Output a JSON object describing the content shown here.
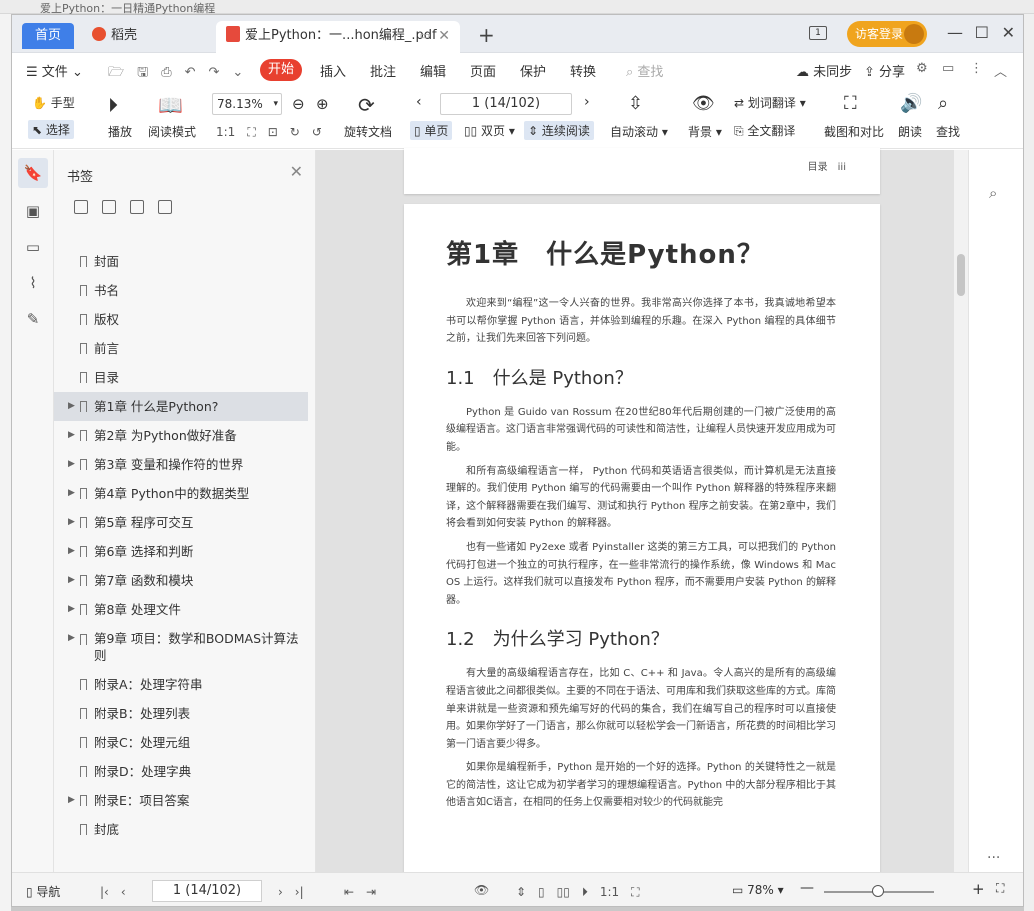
{
  "tabs": {
    "home": "首页",
    "daoke": "稻壳",
    "doc": "爱上Python：一...hon编程_.pdf"
  },
  "account": {
    "guest": "访客登录"
  },
  "menu": {
    "file": "文件",
    "start": "开始",
    "insert": "插入",
    "annotate": "批注",
    "edit": "编辑",
    "page": "页面",
    "protect": "保护",
    "convert": "转换",
    "search": "查找",
    "unsync": "未同步",
    "share": "分享"
  },
  "ribbon": {
    "hand": "手型",
    "select": "选择",
    "play": "播放",
    "read_mode": "阅读模式",
    "zoom": "78.13%",
    "rotate": "旋转文档",
    "page_field": "1 (14/102)",
    "single": "单页",
    "double": "双页",
    "continuous": "连续阅读",
    "auto_scroll": "自动滚动",
    "background": "背景",
    "word_translate": "划词翻译",
    "full_translate": "全文翻译",
    "screenshot": "截图和对比",
    "read_aloud": "朗读",
    "find": "查找"
  },
  "bookmarks": {
    "title": "书签",
    "items": [
      {
        "label": "封面",
        "expandable": false
      },
      {
        "label": "书名",
        "expandable": false
      },
      {
        "label": "版权",
        "expandable": false
      },
      {
        "label": "前言",
        "expandable": false
      },
      {
        "label": "目录",
        "expandable": false
      },
      {
        "label": "第1章 什么是Python?",
        "expandable": true,
        "selected": true
      },
      {
        "label": "第2章 为Python做好准备",
        "expandable": true
      },
      {
        "label": "第3章 变量和操作符的世界",
        "expandable": true
      },
      {
        "label": "第4章 Python中的数据类型",
        "expandable": true
      },
      {
        "label": "第5章 程序可交互",
        "expandable": true
      },
      {
        "label": "第6章 选择和判断",
        "expandable": true
      },
      {
        "label": "第7章 函数和模块",
        "expandable": true
      },
      {
        "label": "第8章 处理文件",
        "expandable": true
      },
      {
        "label": "第9章 项目：数学和BODMAS计算法则",
        "expandable": true,
        "two_line": true
      },
      {
        "label": "附录A：处理字符串",
        "expandable": false
      },
      {
        "label": "附录B：处理列表",
        "expandable": false
      },
      {
        "label": "附录C：处理元组",
        "expandable": false
      },
      {
        "label": "附录D：处理字典",
        "expandable": false
      },
      {
        "label": "附录E：项目答案",
        "expandable": true
      },
      {
        "label": "封底",
        "expandable": false
      }
    ]
  },
  "document": {
    "prev_page_header": "目录　iii",
    "chapter_title": "第1章　什么是Python？",
    "intro": "欢迎来到“编程”这一令人兴奋的世界。我非常高兴你选择了本书，我真诚地希望本书可以帮你掌握 Python 语言，并体验到编程的乐趣。在深入 Python 编程的具体细节之前，让我们先来回答下列问题。",
    "s1_title": "1.1　什么是 Python？",
    "s1_p1": "Python 是 Guido van Rossum 在20世纪80年代后期创建的一门被广泛使用的高级编程语言。这门语言非常强调代码的可读性和简洁性，让编程人员快速开发应用成为可能。",
    "s1_p2": "和所有高级编程语言一样， Python 代码和英语语言很类似，而计算机是无法直接理解的。我们使用 Python 编写的代码需要由一个叫作 Python 解释器的特殊程序来翻译，这个解释器需要在我们编写、测试和执行 Python 程序之前安装。在第2章中，我们将会看到如何安装 Python 的解释器。",
    "s1_p3": "也有一些诸如 Py2exe 或者 Pyinstaller 这类的第三方工具，可以把我们的 Python 代码打包进一个独立的可执行程序，在一些非常流行的操作系统，像 Windows 和 Mac OS 上运行。这样我们就可以直接发布 Python 程序，而不需要用户安装 Python 的解释器。",
    "s2_title": "1.2　为什么学习 Python？",
    "s2_p1": "有大量的高级编程语言存在，比如 C、C++ 和 Java。令人高兴的是所有的高级编程语言彼此之间都很类似。主要的不同在于语法、可用库和我们获取这些库的方式。库简单来讲就是一些资源和预先编写好的代码的集合，我们在编写自己的程序时可以直接使用。如果你学好了一门语言，那么你就可以轻松学会一门新语言，所花费的时间相比学习第一门语言要少得多。",
    "s2_p2": "如果你是编程新手，Python 是开始的一个好的选择。Python 的关键特性之一就是它的简洁性，这让它成为初学者学习的理想编程语言。Python 中的大部分程序相比于其他语言如C语言，在相同的任务上仅需要相对较少的代码就能完"
  },
  "statusbar": {
    "nav": "导航",
    "page_field": "1 (14/102)",
    "zoom": "78%"
  },
  "background_fragments": {
    "top": "爱上Python：一日精通Python编程"
  }
}
